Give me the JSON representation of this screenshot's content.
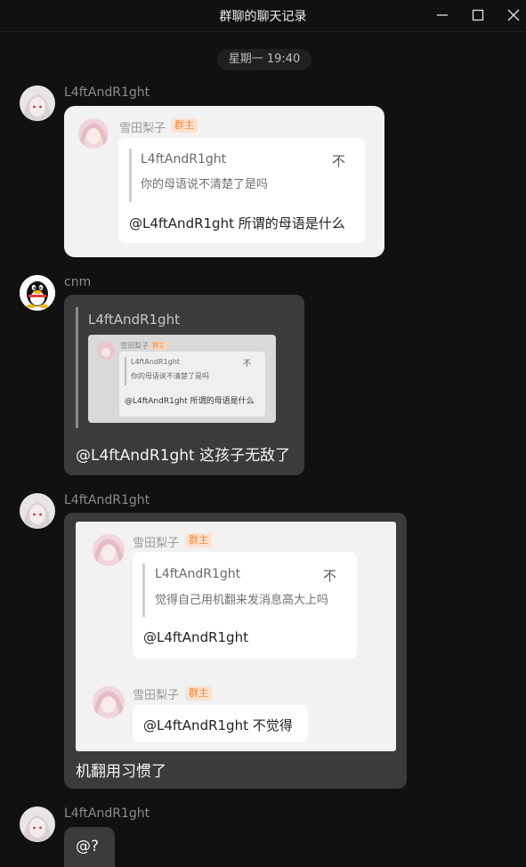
{
  "window": {
    "title": "群聊的聊天记录"
  },
  "timestamp": "星期一 19:40",
  "messages": [
    {
      "sender": "L4ftAndR1ght",
      "forward": {
        "nickname": "雪田梨子",
        "badge": "群主",
        "quote_name": "L4ftAndR1ght",
        "quote_arrow": "不",
        "quote_text": "你的母语说不清楚了是吗",
        "reply": "@L4ftAndR1ght 所谓的母语是什么"
      }
    },
    {
      "sender": "cnm",
      "quote_name": "L4ftAndR1ght",
      "thumb": {
        "nickname": "雪田梨子",
        "badge": "群主",
        "quote_name": "L4ftAndR1ght",
        "quote_arrow": "不",
        "quote_text": "你的母语说不清楚了是吗",
        "reply": "@L4ftAndR1ght 所谓的母语是什么"
      },
      "text": "@L4ftAndR1ght 这孩子无敌了"
    },
    {
      "sender": "L4ftAndR1ght",
      "card": {
        "first": {
          "nickname": "雪田梨子",
          "badge": "群主",
          "quote_name": "L4ftAndR1ght",
          "quote_arrow": "不",
          "quote_text": "觉得自己用机翻来发消息高大上吗",
          "reply": "@L4ftAndR1ght"
        },
        "second": {
          "nickname": "雪田梨子",
          "badge": "群主",
          "reply": "@L4ftAndR1ght 不觉得"
        }
      },
      "text": "机翻用习惯了"
    },
    {
      "sender": "L4ftAndR1ght",
      "text": "@?"
    }
  ],
  "icons": [
    "minimize-icon",
    "maximize-icon",
    "close-icon",
    "penguin-avatar"
  ]
}
